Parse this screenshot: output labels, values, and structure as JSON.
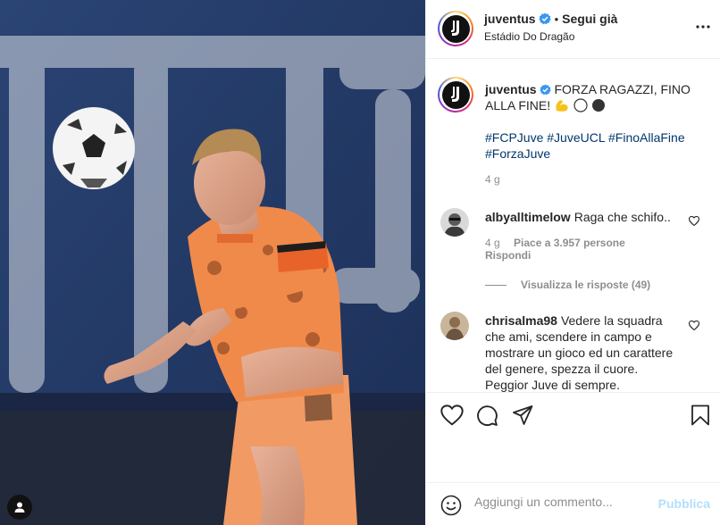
{
  "post": {
    "username": "juventus",
    "follow_label": "Segui già",
    "dot": "•",
    "location": "Estádio Do Dragão",
    "more_icon": "more-horizontal-icon"
  },
  "caption": {
    "username": "juventus",
    "text": "FORZA RAGAZZI, FINO ALLA FINE!",
    "emojis": [
      "flexed-biceps",
      "white-circle",
      "black-circle"
    ],
    "hashtags": [
      "#FCPJuve",
      "#JuveUCL",
      "#FinoAllaFine",
      "#ForzaJuve"
    ],
    "time": "4 g"
  },
  "comments": [
    {
      "username": "albyalltimelow",
      "text": "Raga che schifo..",
      "time": "4 g",
      "likes": "Piace a 3.957 persone",
      "reply": "Rispondi",
      "view_replies": "Visualizza le risposte (49)"
    },
    {
      "username": "chrisalma98",
      "text": "Vedere la squadra che ami, scendere in campo e mostrare un gioco ed un carattere del genere, spezza il cuore. Peggior Juve di sempre."
    }
  ],
  "actions": {
    "like_icon": "heart-icon",
    "comment_icon": "comment-icon",
    "share_icon": "paper-plane-icon",
    "save_icon": "bookmark-icon"
  },
  "add_comment": {
    "placeholder": "Aggiungi un commento...",
    "publish_label": "Pubblica"
  },
  "colors": {
    "link": "#00376b",
    "verified": "#3897f0",
    "muted": "#8e8e8e",
    "publish_disabled": "#b2dffc",
    "jersey": "#f08a4b"
  }
}
